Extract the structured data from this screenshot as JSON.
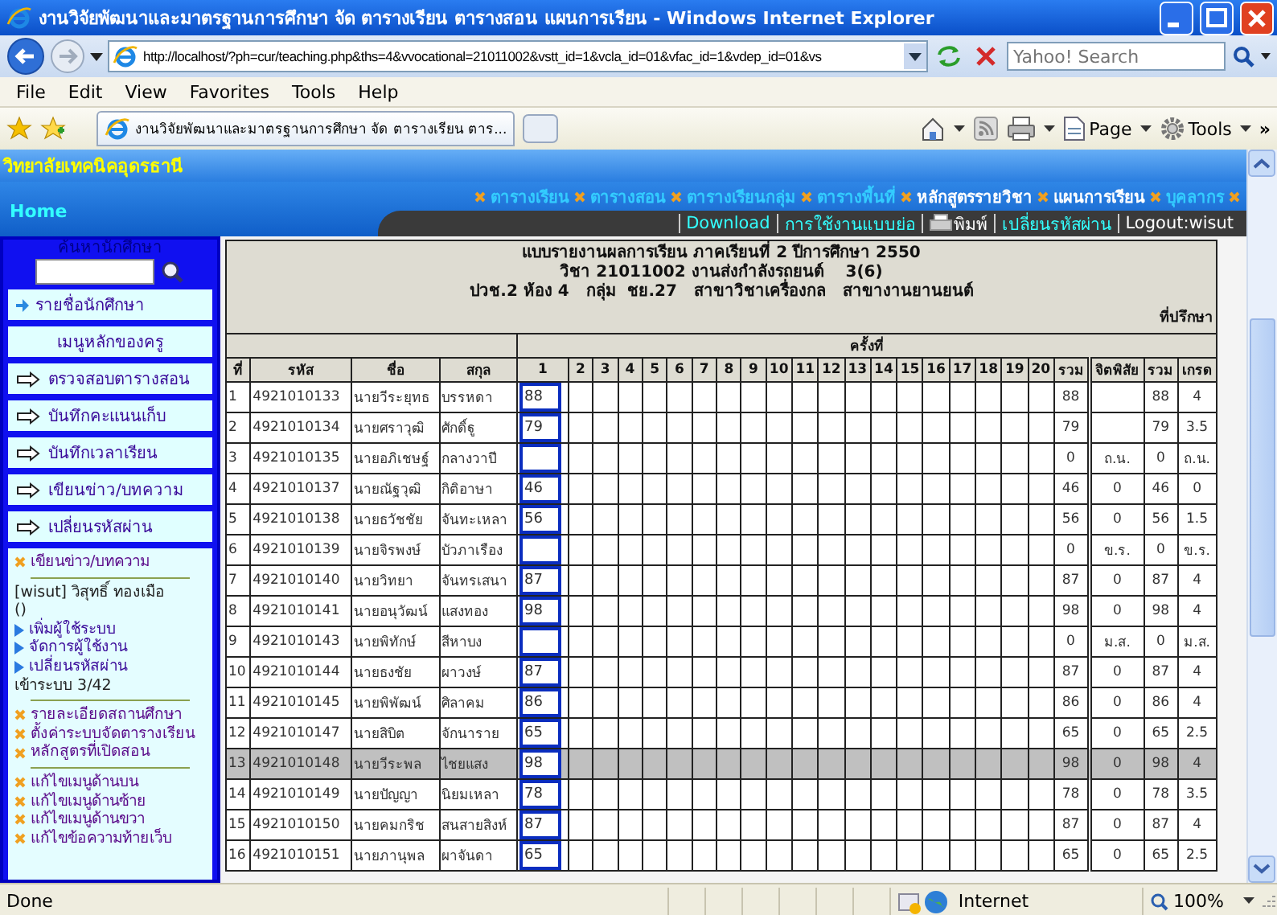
{
  "window": {
    "title": "งานวิจัยพัฒนาและมาตรฐานการศึกษา จัด ตารางเรียน ตารางสอน แผนการเรียน - Windows Internet Explorer"
  },
  "address_bar": {
    "url": "http://localhost/?ph=cur/teaching.php&ths=4&vvocational=21011002&vstt_id=1&vcla_id=01&vfac_id=1&vdep_id=01&vs"
  },
  "search": {
    "placeholder": "Yahoo! Search"
  },
  "menu_bar": [
    "File",
    "Edit",
    "View",
    "Favorites",
    "Tools",
    "Help"
  ],
  "tab": {
    "title": "งานวิจัยพัฒนาและมาตรฐานการศึกษา จัด ตารางเรียน ตาร..."
  },
  "toolbar": [
    "Page",
    "Tools"
  ],
  "toolbar_overflow": "»",
  "page": {
    "site_title": "วิทยาลัยเทคนิคอุดรธานี",
    "home": "Home",
    "nav_links": [
      {
        "label": "ตารางเรียน",
        "color": "#33ccff"
      },
      {
        "label": "ตารางสอน",
        "color": "#33ccff"
      },
      {
        "label": "ตารางเรียนกลุ่ม",
        "color": "#33ccff"
      },
      {
        "label": "ตารางพื้นที่",
        "color": "#33ccff"
      },
      {
        "label": "หลักสูตรรายวิชา",
        "color": "#ffffff"
      },
      {
        "label": "แผนการเรียน",
        "color": "#ffffff"
      },
      {
        "label": "บุคลากร",
        "color": "#33ccff"
      }
    ],
    "user_links": [
      {
        "label": "Download",
        "kind": "link"
      },
      {
        "label": "การใช้งานแบบย่อ",
        "kind": "link"
      },
      {
        "label": "พิมพ์",
        "kind": "print"
      },
      {
        "label": "เปลี่ยนรหัสผ่าน",
        "kind": "link"
      },
      {
        "label": "Logout:wisut",
        "kind": "text"
      }
    ]
  },
  "sidebar": {
    "search_title": "ค้นหานักศึกษา",
    "student_list": "รายชื่อนักศึกษา",
    "menu_title": "เมนูหลักของครู",
    "menu_buttons": [
      "ตรวจสอบตารางสอน",
      "บันทึกคะแนนเก็บ",
      "บันทึกเวลาเรียน",
      "เขียนข่าว/บทความ",
      "เปลี่ยนรหัสผ่าน"
    ],
    "panel_groups": [
      [
        {
          "kind": "link",
          "label": "เขียนข่าว/บทความ"
        }
      ],
      [
        {
          "kind": "text",
          "label": "[wisut] วิสุทธิ์ ทองเมือ"
        },
        {
          "kind": "text",
          "label": "()"
        },
        {
          "kind": "sublink",
          "label": "เพิ่มผู้ใช้ระบบ"
        },
        {
          "kind": "sublink",
          "label": "จัดการผู้ใช้งาน"
        },
        {
          "kind": "sublink",
          "label": "เปลี่ยนรหัสผ่าน"
        },
        {
          "kind": "text",
          "label": "เข้าระบบ 3/42"
        }
      ],
      [
        {
          "kind": "link",
          "label": "รายละเอียดสถานศึกษา"
        },
        {
          "kind": "link",
          "label": "ตั้งค่าระบบจัดตารางเรียน"
        },
        {
          "kind": "link",
          "label": "หลักสูตรที่เปิดสอน"
        }
      ],
      [
        {
          "kind": "link",
          "label": "แก้ไขเมนูด้านบน"
        },
        {
          "kind": "link",
          "label": "แก้ไขเมนูด้านซ้าย"
        },
        {
          "kind": "link",
          "label": "แก้ไขเมนูด้านขวา"
        },
        {
          "kind": "link",
          "label": "แก้ไขข้อความท้ายเว็บ"
        }
      ]
    ]
  },
  "report": {
    "title_lines": [
      "แบบรายงานผลการเรียน ภาคเรียนที่ 2 ปีการศึกษา 2550",
      "วิชา 21011002 งานส่งกำลังรถยนต์    3(6)",
      "ปวช.2 ห้อง 4   กลุ่ม  ชย.27   สาขาวิชาเครื่องกล   สาขางานยานยนต์"
    ],
    "advisor_label": "ที่ปรึกษา",
    "session_header": "ครั้งที่",
    "columns": [
      "ที่",
      "รหัส",
      "ชื่อ",
      "สกุล",
      "1",
      "2",
      "3",
      "4",
      "5",
      "6",
      "7",
      "8",
      "9",
      "10",
      "11",
      "12",
      "13",
      "14",
      "15",
      "16",
      "17",
      "18",
      "19",
      "20",
      "รวม",
      "จิตพิสัย",
      "รวม",
      "เกรด"
    ],
    "rows": [
      {
        "no": "1",
        "id": "4921010133",
        "first_name": "นายวีระยุทธ",
        "last_name": "บรรหดา",
        "score_1": "88",
        "total": "88",
        "net": "88",
        "grade": "4",
        "selected": false
      },
      {
        "no": "2",
        "id": "4921010134",
        "first_name": "นายศราวุฒิ",
        "last_name": "ศักดิ์ฐู",
        "score_1": "79",
        "total": "79",
        "net": "79",
        "grade": "3.5",
        "selected": false
      },
      {
        "no": "3",
        "id": "4921010135",
        "first_name": "นายอภิเชษฐ์",
        "last_name": "กลางวาปี",
        "total": "0",
        "attitude": "ถ.น.",
        "net": "0",
        "grade": "ถ.น.",
        "selected": false
      },
      {
        "no": "4",
        "id": "4921010137",
        "first_name": "นายณัฐวุฒิ",
        "last_name": "กิติอาษา",
        "score_1": "46",
        "total": "46",
        "attitude": "0",
        "net": "46",
        "grade": "0",
        "selected": false
      },
      {
        "no": "5",
        "id": "4921010138",
        "first_name": "นายธวัชชัย",
        "last_name": "จันทะเหลา",
        "score_1": "56",
        "total": "56",
        "attitude": "0",
        "net": "56",
        "grade": "1.5",
        "selected": false
      },
      {
        "no": "6",
        "id": "4921010139",
        "first_name": "นายจิรพงษ์",
        "last_name": "บัวภาเรือง",
        "total": "0",
        "attitude": "ข.ร.",
        "net": "0",
        "grade": "ข.ร.",
        "selected": false
      },
      {
        "no": "7",
        "id": "4921010140",
        "first_name": "นายวิทยา",
        "last_name": "จันทรเสนา",
        "score_1": "87",
        "total": "87",
        "attitude": "0",
        "net": "87",
        "grade": "4",
        "selected": false
      },
      {
        "no": "8",
        "id": "4921010141",
        "first_name": "นายอนุวัฒน์",
        "last_name": "แสงทอง",
        "score_1": "98",
        "total": "98",
        "attitude": "0",
        "net": "98",
        "grade": "4",
        "selected": false
      },
      {
        "no": "9",
        "id": "4921010143",
        "first_name": "นายพิทักษ์",
        "last_name": "สีหาบง",
        "total": "0",
        "attitude": "ม.ส.",
        "net": "0",
        "grade": "ม.ส.",
        "selected": false
      },
      {
        "no": "10",
        "id": "4921010144",
        "first_name": "นายธงชัย",
        "last_name": "ผาวงษ์",
        "score_1": "87",
        "total": "87",
        "attitude": "0",
        "net": "87",
        "grade": "4",
        "selected": false
      },
      {
        "no": "11",
        "id": "4921010145",
        "first_name": "นายพิพัฒน์",
        "last_name": "ศิลาคม",
        "score_1": "86",
        "total": "86",
        "attitude": "0",
        "net": "86",
        "grade": "4",
        "selected": false
      },
      {
        "no": "12",
        "id": "4921010147",
        "first_name": "นายสิบิต",
        "last_name": "จักนาราย",
        "score_1": "65",
        "total": "65",
        "attitude": "0",
        "net": "65",
        "grade": "2.5",
        "selected": false
      },
      {
        "no": "13",
        "id": "4921010148",
        "first_name": "นายวีระพล",
        "last_name": "ไชยแสง",
        "score_1": "98",
        "total": "98",
        "attitude": "0",
        "net": "98",
        "grade": "4",
        "selected": true
      },
      {
        "no": "14",
        "id": "4921010149",
        "first_name": "นายปัญญา",
        "last_name": "นิยมเหลา",
        "score_1": "78",
        "total": "78",
        "attitude": "0",
        "net": "78",
        "grade": "3.5",
        "selected": false
      },
      {
        "no": "15",
        "id": "4921010150",
        "first_name": "นายคมกริช",
        "last_name": "สนสายสิงห์",
        "score_1": "87",
        "total": "87",
        "attitude": "0",
        "net": "87",
        "grade": "4",
        "selected": false
      },
      {
        "no": "16",
        "id": "4921010151",
        "first_name": "นายภานุพล",
        "last_name": "ผาจันดา",
        "score_1": "65",
        "total": "65",
        "attitude": "0",
        "net": "65",
        "grade": "2.5",
        "selected": false
      }
    ]
  },
  "status_bar": {
    "text": "Done",
    "zone": "Internet",
    "zoom": "100%"
  }
}
